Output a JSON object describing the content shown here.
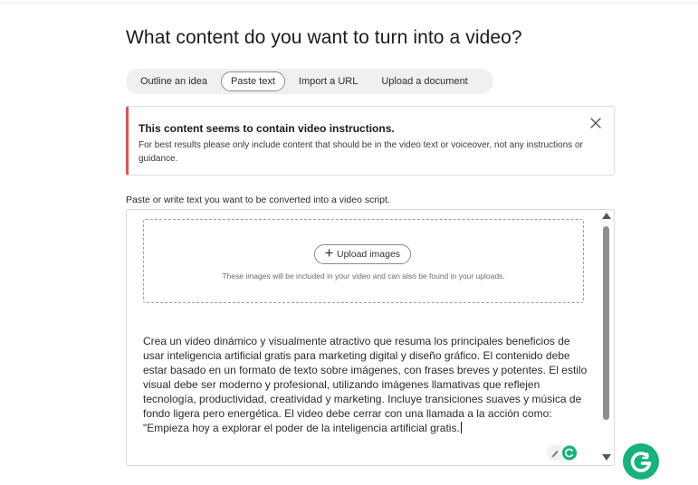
{
  "page": {
    "title": "What content do you want to turn into a video?"
  },
  "tabs": [
    {
      "label": "Outline an idea",
      "active": false
    },
    {
      "label": "Paste text",
      "active": true
    },
    {
      "label": "Import a URL",
      "active": false
    },
    {
      "label": "Upload a document",
      "active": false
    }
  ],
  "alert": {
    "title": "This content seems to contain video instructions.",
    "body": "For best results please only include content that should be in the video text or voiceover, not any instructions or guidance.",
    "accent_color": "#e0524a",
    "close_icon": "close-icon"
  },
  "editor": {
    "label": "Paste or write text you want to be converted into a video script.",
    "upload_button": "Upload images",
    "upload_icon": "plus-icon",
    "upload_hint": "These images will be included in your video and can also be found in your uploads.",
    "text": "Crea un video dinámico y visualmente atractivo que resuma los principales beneficios de usar inteligencia artificial gratis para marketing digital y diseño gráfico. El contenido debe estar basado en un formato de texto sobre imágenes, con frases breves y potentes. El estilo visual debe ser moderno y profesional, utilizando imágenes llamativas que reflejen tecnología, productividad, creatividad y marketing. Incluye transiciones suaves y música de fondo ligera pero energética. El video debe cerrar con una llamada a la acción como: \"Empieza hoy a explorar el poder de la inteligencia artificial gratis."
  },
  "grammarly": {
    "brand_color": "#15b27a",
    "icon": "grammarly-icon"
  }
}
